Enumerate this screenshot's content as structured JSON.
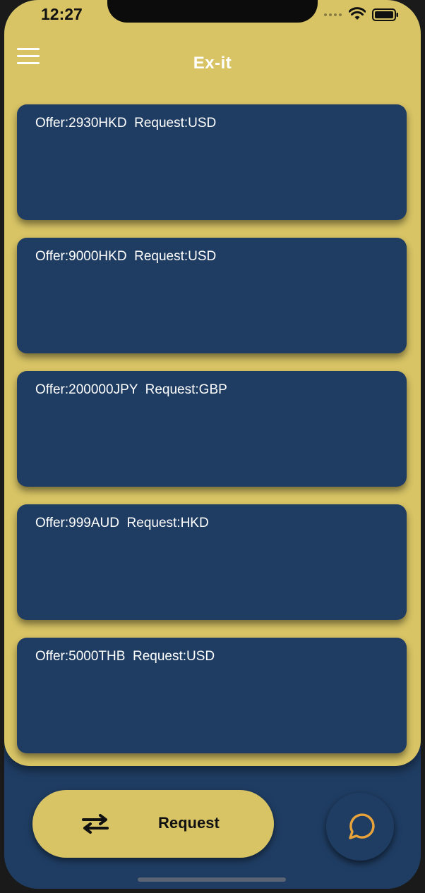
{
  "status_bar": {
    "time": "12:27"
  },
  "header": {
    "title": "Ex-it",
    "menu_icon": "hamburger-menu-icon"
  },
  "offers": [
    {
      "text": "Offer:2930HKD  Request:USD"
    },
    {
      "text": "Offer:9000HKD  Request:USD"
    },
    {
      "text": "Offer:200000JPY  Request:GBP"
    },
    {
      "text": "Offer:999AUD  Request:HKD"
    },
    {
      "text": "Offer:5000THB  Request:USD"
    }
  ],
  "footer": {
    "request_label": "Request",
    "request_icon": "swap-arrows-icon",
    "chat_icon": "chat-bubble-icon"
  },
  "colors": {
    "background_yellow": "#d8c465",
    "navy": "#1f3d63",
    "chat_icon_orange": "#e8a33a",
    "text_white": "#ffffff"
  }
}
